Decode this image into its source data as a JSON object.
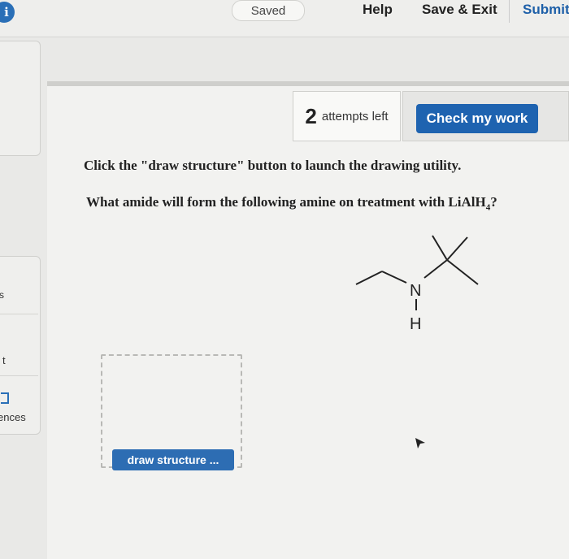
{
  "header": {
    "info_icon_label": "i",
    "saved_label": "Saved",
    "help_label": "Help",
    "save_exit_label": "Save & Exit",
    "submit_label": "Submit"
  },
  "sidebar": {
    "fragment_t": "t",
    "fragment_ences": "ences",
    "fragment_s": "s"
  },
  "attempts": {
    "count": "2",
    "label": "attempts left"
  },
  "check_button_label": "Check my work",
  "instruction_text": "Click the \"draw structure\" button to launch the drawing utility.",
  "question": {
    "text_before": "What amide will form the following amine on treatment with LiAlH",
    "subscript": "4",
    "text_after": "?"
  },
  "molecule": {
    "atom_n": "N",
    "atom_h": "H"
  },
  "draw_button_label": "draw structure ...",
  "colors": {
    "accent_blue": "#1e63b0",
    "submit_blue": "#1d5fa8"
  }
}
